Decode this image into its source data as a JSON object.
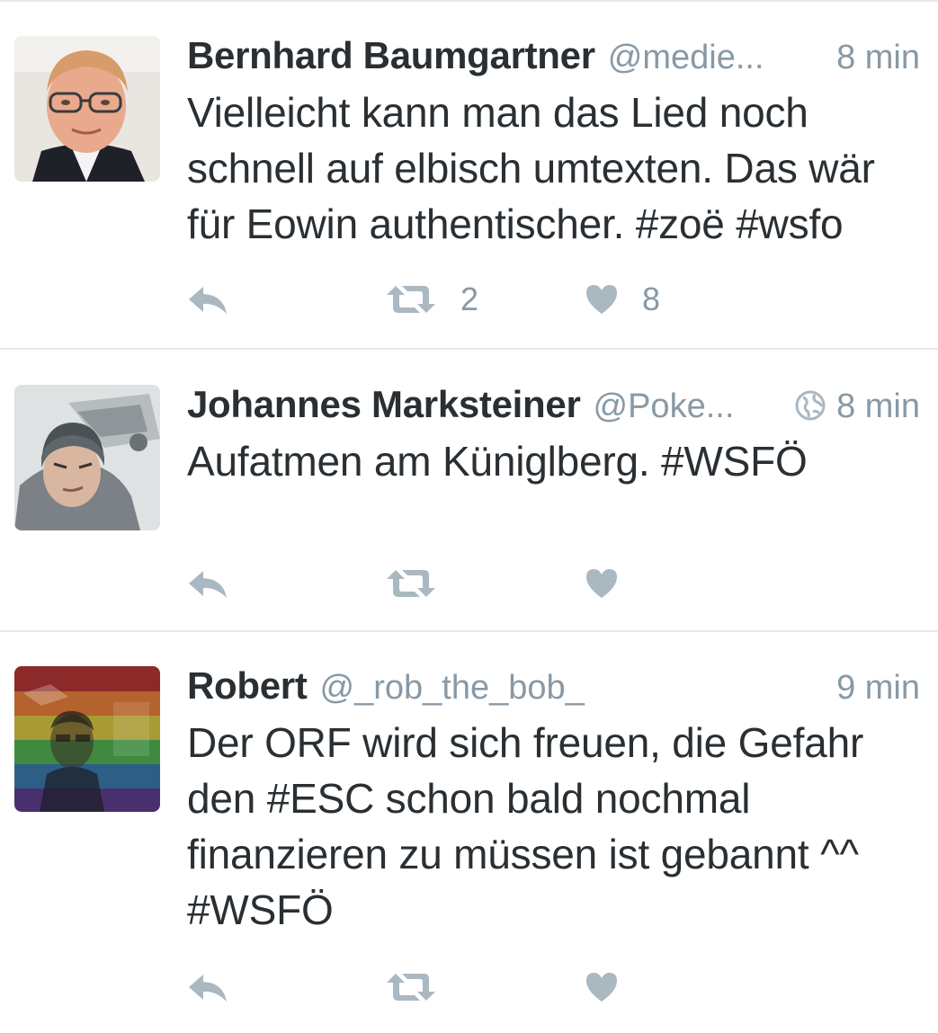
{
  "tweets": [
    {
      "name": "Bernhard Baumgartner",
      "handle": "@medie...",
      "time": "8 min",
      "text": "Vielleicht kann man das Lied noch schnell auf elbisch umtexten. Das wär für Eowin authentischer. #zoë #wsfo",
      "retweets": "2",
      "likes": "8",
      "avatar_icon": "avatar-photo-man-glasses"
    },
    {
      "name": "Johannes Marksteiner",
      "handle": "@Poke...",
      "time": "8 min",
      "geo_icon": "globe-icon",
      "text": "Aufatmen am Küniglberg. #WSFÖ",
      "retweets": "",
      "likes": "",
      "avatar_icon": "avatar-photo-man-beanie"
    },
    {
      "name": "Robert",
      "handle": "@_rob_the_bob_",
      "time": "9 min",
      "text": "Der ORF wird sich freuen, die Gefahr den #ESC schon bald nochmal finanzieren zu müssen ist gebannt ^^ #WSFÖ",
      "retweets": "",
      "likes": "",
      "avatar_icon": "avatar-photo-rainbow-overlay"
    }
  ],
  "icons": {
    "reply": "reply-icon",
    "retweet": "retweet-icon",
    "like": "heart-icon"
  },
  "colors": {
    "text": "#292f33",
    "secondary": "#8899a6",
    "action_icon": "#aab8c2",
    "divider": "#e1e8ed"
  }
}
